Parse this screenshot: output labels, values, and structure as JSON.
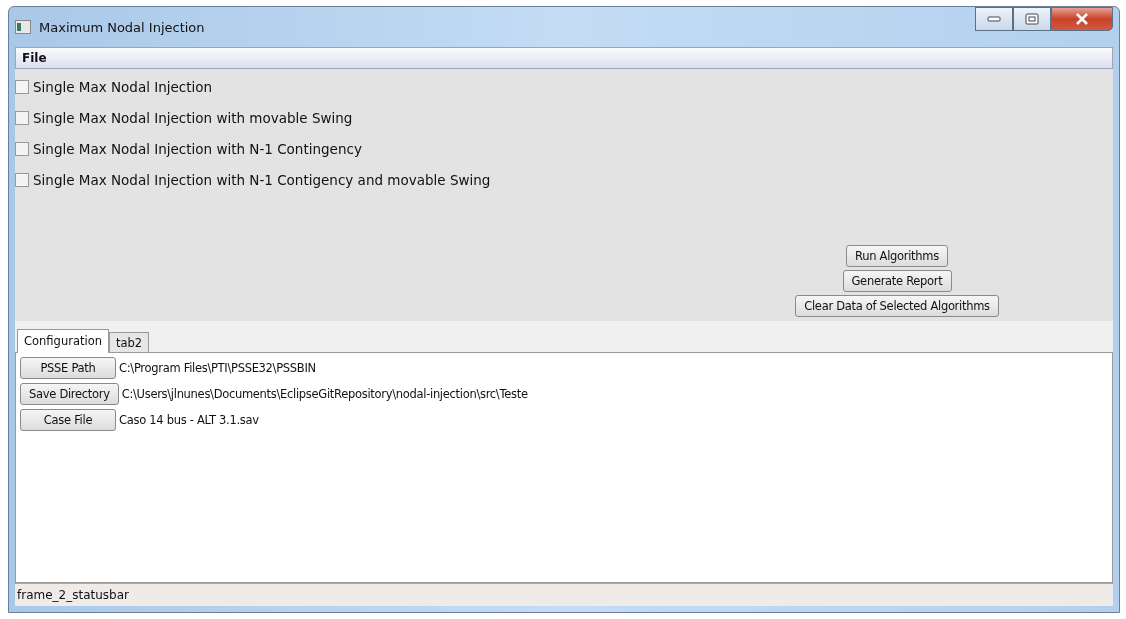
{
  "window": {
    "title": "Maximum Nodal Injection"
  },
  "menu": [
    "File"
  ],
  "algorithms": [
    {
      "label": "Single Max Nodal Injection",
      "checked": false
    },
    {
      "label": "Single Max Nodal Injection with movable Swing",
      "checked": false
    },
    {
      "label": "Single Max Nodal Injection with N-1 Contingency",
      "checked": false
    },
    {
      "label": "Single Max Nodal Injection with N-1 Contigency and movable Swing",
      "checked": false
    }
  ],
  "actions": [
    "Run Algorithms",
    "Generate Report",
    "Clear Data of Selected Algorithms"
  ],
  "tabs": [
    {
      "label": "Configuration",
      "selected": true
    },
    {
      "label": "tab2",
      "selected": false
    }
  ],
  "config": [
    {
      "button": "PSSE Path",
      "value": "C:\\Program Files\\PTI\\PSSE32\\PSSBIN"
    },
    {
      "button": "Save Directory",
      "value": "C:\\Users\\jlnunes\\Documents\\EclipseGitRepository\\nodal-injection\\src\\Teste"
    },
    {
      "button": "Case File",
      "value": "Caso 14 bus - ALT 3.1.sav"
    }
  ],
  "status_bar": "frame_2_statusbar"
}
